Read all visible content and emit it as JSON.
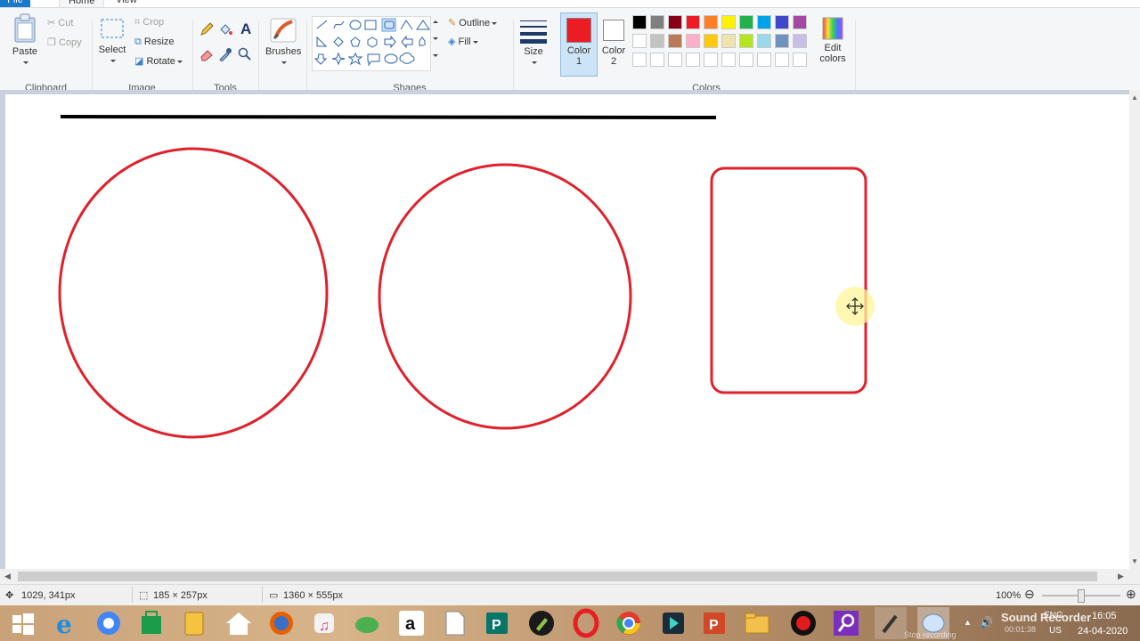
{
  "tabs": {
    "file": "File",
    "home": "Home",
    "view": "View"
  },
  "clipboard": {
    "paste": "Paste",
    "cut": "Cut",
    "copy": "Copy",
    "label": "Clipboard"
  },
  "image": {
    "select": "Select",
    "crop": "Crop",
    "resize": "Resize",
    "rotate": "Rotate",
    "label": "Image"
  },
  "tools": {
    "label": "Tools"
  },
  "brushes": {
    "label": "Brushes"
  },
  "shapes": {
    "outline": "Outline",
    "fill": "Fill",
    "label": "Shapes"
  },
  "size": {
    "label": "Size"
  },
  "color1": {
    "label": "Color",
    "num": "1",
    "value": "#ed1c24"
  },
  "color2": {
    "label": "Color",
    "num": "2",
    "value": "#ffffff"
  },
  "colors": {
    "label": "Colors",
    "edit": "Edit",
    "edit2": "colors",
    "row1": [
      "#000000",
      "#7f7f7f",
      "#880015",
      "#ed1c24",
      "#ff7f27",
      "#fff200",
      "#22b14c",
      "#00a2e8",
      "#3f48cc",
      "#a349a4"
    ],
    "row2": [
      "#ffffff",
      "#c3c3c3",
      "#b97a57",
      "#ffaec9",
      "#ffc90e",
      "#efe4b0",
      "#b5e61d",
      "#99d9ea",
      "#7092be",
      "#c8bfe7"
    ]
  },
  "status": {
    "cursor": "1029, 341px",
    "selection": "185 × 257px",
    "canvas": "1360 × 555px",
    "zoom": "100%"
  },
  "tray": {
    "lang": "ENG",
    "region": "US",
    "time": "16:05",
    "date": "24-04-2020",
    "recorder": "Sound Recorder",
    "stop": "Stop recording",
    "elapsed": "00:01:38"
  }
}
